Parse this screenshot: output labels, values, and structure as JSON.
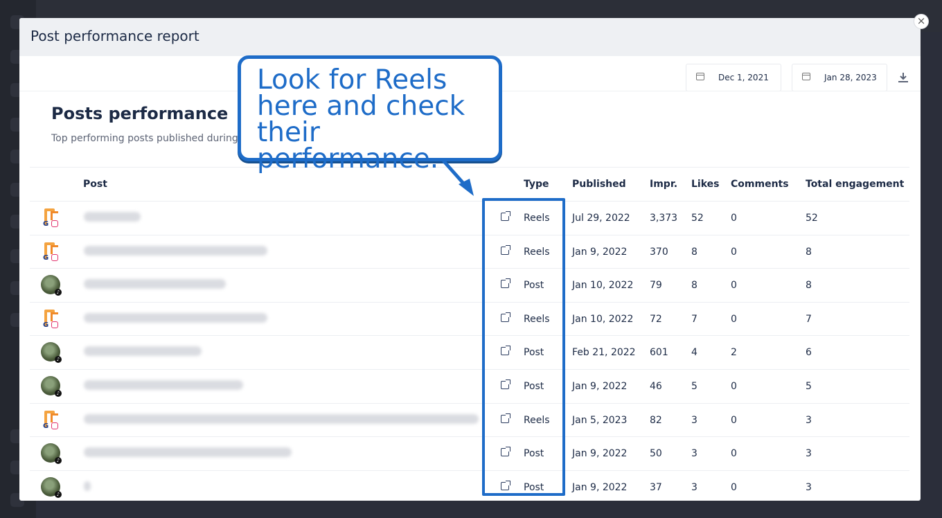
{
  "modal": {
    "title": "Post performance report",
    "close": "×"
  },
  "date_range": {
    "start": "Dec 1, 2021",
    "end": "Jan 28, 2023"
  },
  "section": {
    "title": "Posts performance",
    "subtitle": "Top performing posts published during t"
  },
  "callout": {
    "text": "Look for Reels here and check their performance."
  },
  "table": {
    "headers": {
      "post": "Post",
      "type": "Type",
      "published": "Published",
      "impr": "Impr.",
      "likes": "Likes",
      "comments": "Comments",
      "total": "Total engagement"
    },
    "rows": [
      {
        "network": "instagram",
        "type": "Reels",
        "published": "Jul 29, 2022",
        "impr": "3,373",
        "likes": "52",
        "comments": "0",
        "total": "52"
      },
      {
        "network": "instagram",
        "type": "Reels",
        "published": "Jan 9, 2022",
        "impr": "370",
        "likes": "8",
        "comments": "0",
        "total": "8"
      },
      {
        "network": "tiktok",
        "type": "Post",
        "published": "Jan 10, 2022",
        "impr": "79",
        "likes": "8",
        "comments": "0",
        "total": "8"
      },
      {
        "network": "instagram",
        "type": "Reels",
        "published": "Jan 10, 2022",
        "impr": "72",
        "likes": "7",
        "comments": "0",
        "total": "7"
      },
      {
        "network": "tiktok",
        "type": "Post",
        "published": "Feb 21, 2022",
        "impr": "601",
        "likes": "4",
        "comments": "2",
        "total": "6"
      },
      {
        "network": "tiktok",
        "type": "Post",
        "published": "Jan 9, 2022",
        "impr": "46",
        "likes": "5",
        "comments": "0",
        "total": "5"
      },
      {
        "network": "instagram",
        "type": "Reels",
        "published": "Jan 5, 2023",
        "impr": "82",
        "likes": "3",
        "comments": "0",
        "total": "3"
      },
      {
        "network": "tiktok",
        "type": "Post",
        "published": "Jan 9, 2022",
        "impr": "50",
        "likes": "3",
        "comments": "0",
        "total": "3"
      },
      {
        "network": "tiktok",
        "type": "Post",
        "published": "Jan 9, 2022",
        "impr": "37",
        "likes": "3",
        "comments": "0",
        "total": "3"
      }
    ]
  },
  "colors": {
    "accent": "#1e6cc8",
    "text": "#1c2a45",
    "overlay": "#2b2e3a"
  }
}
